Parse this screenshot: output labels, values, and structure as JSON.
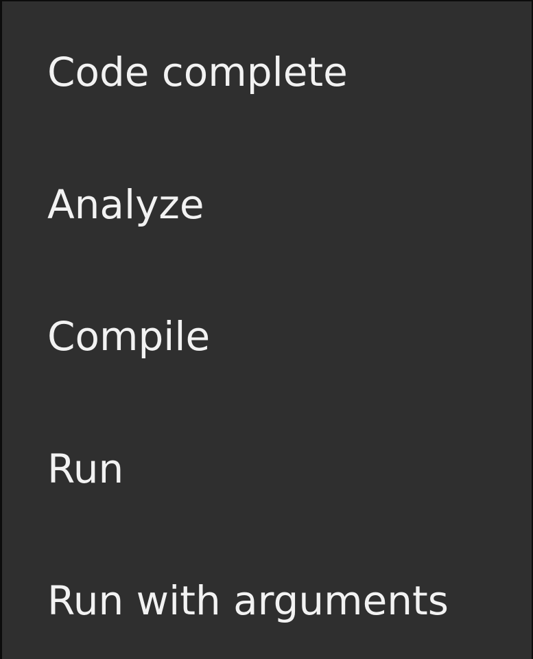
{
  "menu": {
    "items": [
      {
        "label": "Code complete"
      },
      {
        "label": "Analyze"
      },
      {
        "label": "Compile"
      },
      {
        "label": "Run"
      },
      {
        "label": "Run with arguments"
      }
    ]
  },
  "colors": {
    "menu_background": "#2f2f2f",
    "menu_text": "#f2f2f2",
    "border": "#0c0c0c"
  }
}
